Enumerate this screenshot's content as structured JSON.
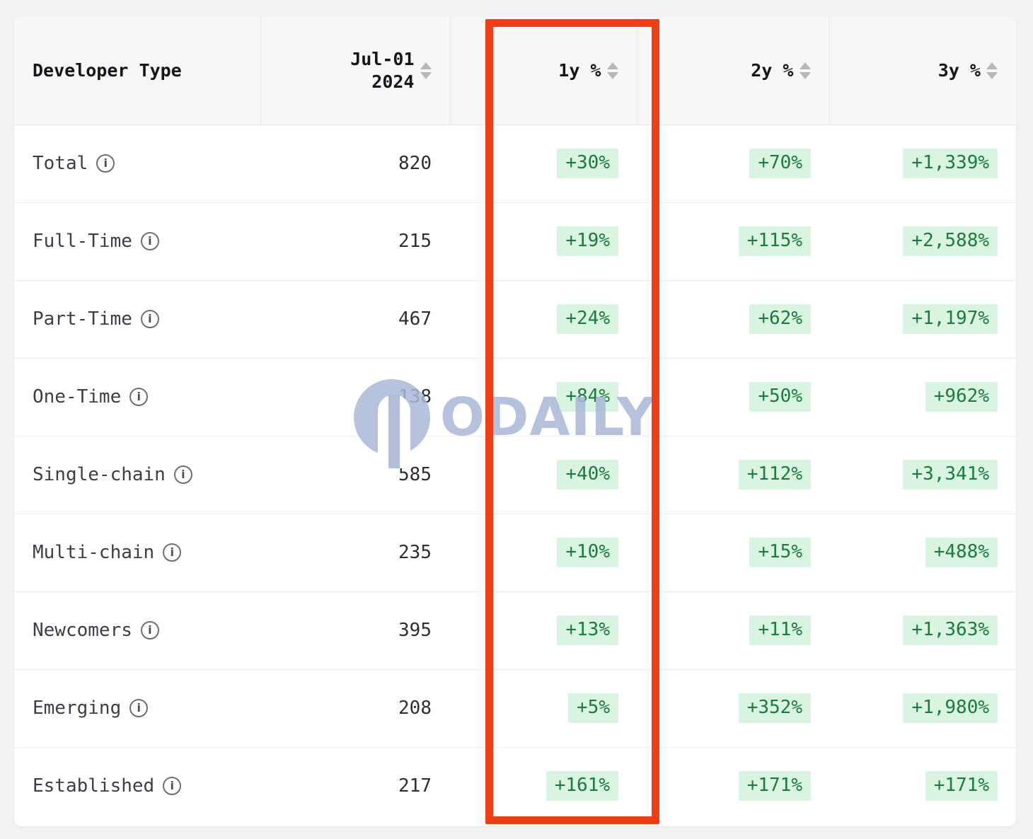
{
  "watermark": {
    "text": "ODAILY",
    "logo_icon": "odaily-logo-icon"
  },
  "table": {
    "columns": [
      {
        "key": "type",
        "label": "Developer Type",
        "align": "left",
        "sortable": false
      },
      {
        "key": "date",
        "label": "Jul-01\n2024",
        "align": "right",
        "sortable": true
      },
      {
        "key": "y1",
        "label": "1y %",
        "align": "right",
        "sortable": true
      },
      {
        "key": "y2",
        "label": "2y %",
        "align": "right",
        "sortable": true
      },
      {
        "key": "y3",
        "label": "3y %",
        "align": "right",
        "sortable": true
      }
    ],
    "info_icon_glyph": "i",
    "rows": [
      {
        "type": "Total",
        "date": "820",
        "y1": "+30%",
        "y2": "+70%",
        "y3": "+1,339%"
      },
      {
        "type": "Full-Time",
        "date": "215",
        "y1": "+19%",
        "y2": "+115%",
        "y3": "+2,588%"
      },
      {
        "type": "Part-Time",
        "date": "467",
        "y1": "+24%",
        "y2": "+62%",
        "y3": "+1,197%"
      },
      {
        "type": "One-Time",
        "date": "138",
        "y1": "+84%",
        "y2": "+50%",
        "y3": "+962%"
      },
      {
        "type": "Single-chain",
        "date": "585",
        "y1": "+40%",
        "y2": "+112%",
        "y3": "+3,341%"
      },
      {
        "type": "Multi-chain",
        "date": "235",
        "y1": "+10%",
        "y2": "+15%",
        "y3": "+488%"
      },
      {
        "type": "Newcomers",
        "date": "395",
        "y1": "+13%",
        "y2": "+11%",
        "y3": "+1,363%"
      },
      {
        "type": "Emerging",
        "date": "208",
        "y1": "+5%",
        "y2": "+352%",
        "y3": "+1,980%"
      },
      {
        "type": "Established",
        "date": "217",
        "y1": "+161%",
        "y2": "+171%",
        "y3": "+171%"
      }
    ]
  },
  "annotation": {
    "highlighted_column": "1y %",
    "color": "#ef3d15"
  },
  "colors": {
    "page_background": "#f2f2f2",
    "card_background": "#ffffff",
    "header_background": "#f7f7f8",
    "badge_background": "#d9f5e1",
    "badge_text": "#1d7a3f",
    "watermark": "#aab8d6"
  }
}
